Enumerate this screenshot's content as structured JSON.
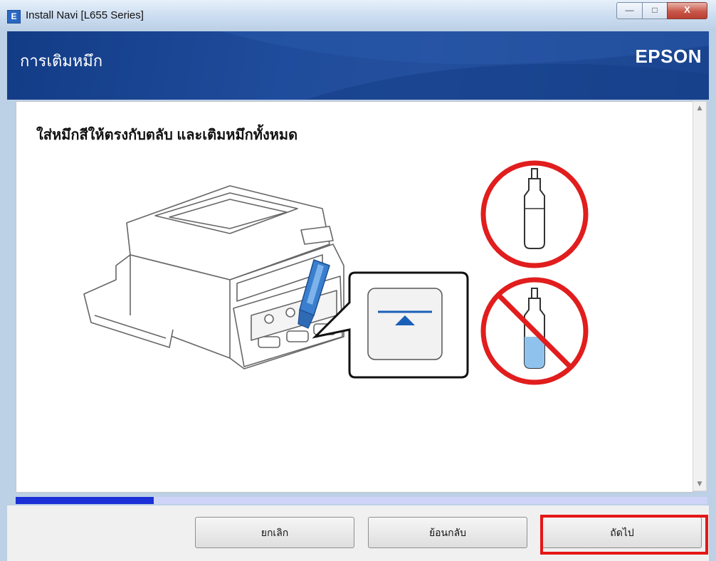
{
  "window": {
    "title": "Install Navi [L655 Series]",
    "icon_letter": "E",
    "controls": {
      "minimize": "—",
      "maximize": "□",
      "close": "X"
    }
  },
  "header": {
    "title": "การเติมหมึก",
    "brand": "EPSON"
  },
  "content": {
    "instruction": "ใส่หมึกสีให้ตรงกับตลับ และเติมหมึกทั้งหมด",
    "illustration": {
      "correct_icon": "ink-bottle-ok-icon",
      "prohibited_icon": "ink-bottle-prohibited-icon",
      "level_marker": "upper-fill-line-icon"
    }
  },
  "progress": {
    "value": 0.2
  },
  "buttons": {
    "cancel": "ยกเลิก",
    "back": "ย้อนกลับ",
    "next": "ถัดไป"
  },
  "colors": {
    "header_blue": "#1f4c9c",
    "highlight_red": "#e51616",
    "progress_fill": "#1b2fd6",
    "ink_blue": "#3a7fcf"
  }
}
